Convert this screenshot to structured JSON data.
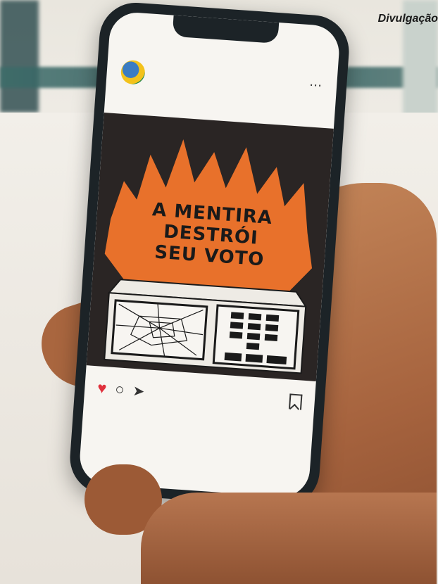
{
  "credit": "Divulgação",
  "post": {
    "username": "",
    "headline": [
      "A MENTIRA",
      "DESTRÓI",
      "SEU VOTO"
    ],
    "likes_text": "",
    "caption_text": ""
  },
  "colors": {
    "flame": "#e8712b",
    "post_bg": "#2a2524",
    "urn_body": "#eeebe5",
    "like": "#e0303c"
  },
  "icons": [
    "more-icon",
    "heart-icon",
    "comment-icon",
    "send-icon",
    "bookmark-icon"
  ]
}
